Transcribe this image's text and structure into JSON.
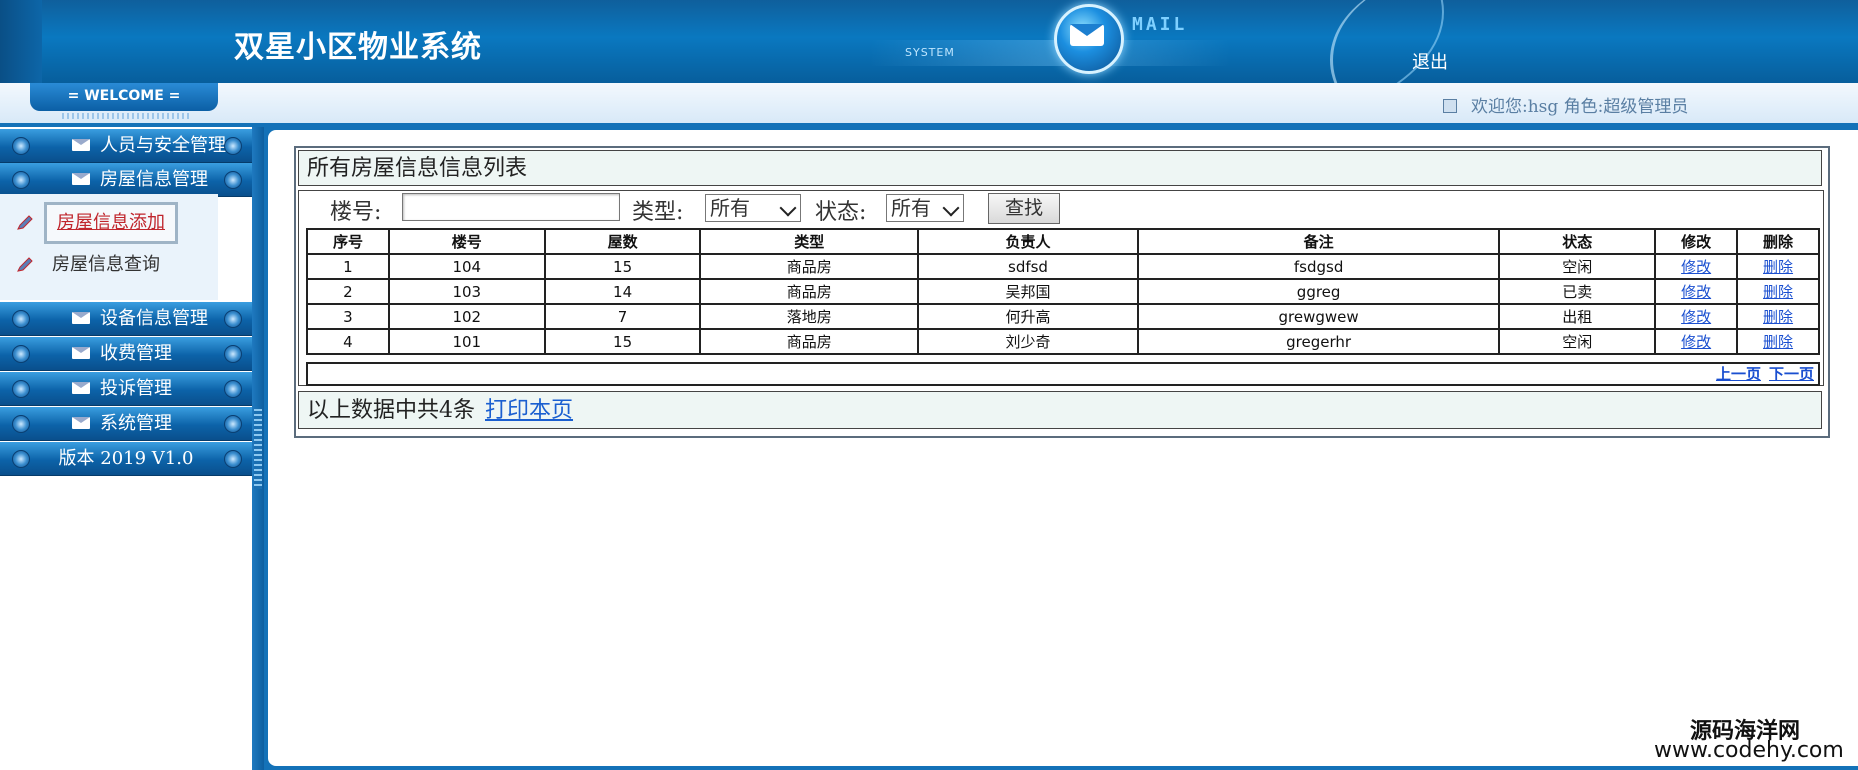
{
  "header": {
    "title": "双星小区物业系统",
    "system_text": "SYSTEM",
    "mail_text": "MAIL",
    "logout_label": "退出"
  },
  "welcome": {
    "tab_label": "= WELCOME =",
    "user_text": "欢迎您:hsg 角色:超级管理员"
  },
  "sidebar": {
    "menus": [
      {
        "label": "人员与安全管理"
      },
      {
        "label": "房屋信息管理"
      },
      {
        "label": "设备信息管理"
      },
      {
        "label": "收费管理"
      },
      {
        "label": "投诉管理"
      },
      {
        "label": "系统管理"
      },
      {
        "label": "版本 2019 V1.0"
      }
    ],
    "subitems": [
      {
        "label": "房屋信息添加"
      },
      {
        "label": "房屋信息查询"
      }
    ]
  },
  "main": {
    "panel_title": "所有房屋信息信息列表",
    "search": {
      "building_label": "楼号:",
      "building_value": "",
      "type_label": "类型:",
      "type_selected": "所有",
      "status_label": "状态:",
      "status_selected": "所有",
      "search_button": "查找"
    },
    "table": {
      "headers": [
        "序号",
        "楼号",
        "屋数",
        "类型",
        "负责人",
        "备注",
        "状态",
        "修改",
        "删除"
      ],
      "rows": [
        [
          "1",
          "104",
          "15",
          "商品房",
          "sdfsd",
          "fsdgsd",
          "空闲",
          "修改",
          "删除"
        ],
        [
          "2",
          "103",
          "14",
          "商品房",
          "吴邦国",
          "ggreg",
          "已卖",
          "修改",
          "删除"
        ],
        [
          "3",
          "102",
          "7",
          "落地房",
          "何升高",
          "grewgwew",
          "出租",
          "修改",
          "删除"
        ],
        [
          "4",
          "101",
          "15",
          "商品房",
          "刘少奇",
          "gregerhr",
          "空闲",
          "修改",
          "删除"
        ]
      ]
    },
    "pager": {
      "prev": "上一页",
      "next": "下一页"
    },
    "footer": {
      "summary": "以上数据中共4条",
      "print_link": "打印本页"
    }
  },
  "watermark": {
    "line1": "源码海洋网",
    "line2": "www.codehy.com"
  }
}
